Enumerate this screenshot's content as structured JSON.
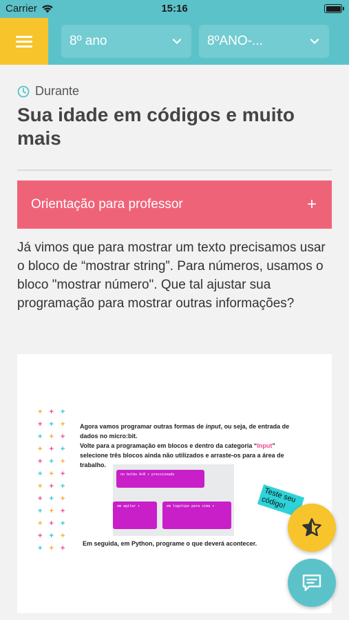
{
  "status_bar": {
    "carrier": "Carrier",
    "time": "15:16"
  },
  "header": {
    "menu_icon": "hamburger-menu-icon",
    "grade_select": {
      "value": "8º ano"
    },
    "class_select": {
      "value": "8ºANO-..."
    }
  },
  "lesson": {
    "phase_icon": "clock-icon",
    "phase": "Durante",
    "title": "Sua idade em códigos e muito mais",
    "teacher_guidance": {
      "label": "Orientação para professor",
      "expand_symbol": "+"
    },
    "body": "Já vimos que para mostrar um texto precisamos usar o bloco de “mostrar string”. Para números, usamos o bloco \"mostrar número\". Que tal ajustar sua programação para mostrar outras informações?"
  },
  "slide_image": {
    "line1_a": "Agora vamos programar outras formas de ",
    "line1_b": "input",
    "line1_c": ", ou seja, de entrada de dados no micro:bit.",
    "line2_a": "Volte para a programação em blocos e dentro da categoria “",
    "line2_b": "Input",
    "line2_c": "” selecione três blocos ainda não utilizados e arraste-os para a área de trabalho.",
    "block1": "no botão  A+B ▾  pressionado",
    "block2": "em  agitar ▾",
    "block3": "em  logotipo para cima ▾",
    "footer": "Em seguida, em Python, programe o que deverá acontecer.",
    "sticker": "Teste seu código!",
    "plus_colors": [
      "#f7a72c",
      "#e94a8a",
      "#2dc6d0"
    ]
  },
  "fabs": {
    "favorite_icon": "star-icon",
    "chat_icon": "chat-bubble-icon"
  },
  "colors": {
    "teal": "#5cc2c9",
    "yellow": "#f7c42c",
    "pink": "#ef6379"
  }
}
